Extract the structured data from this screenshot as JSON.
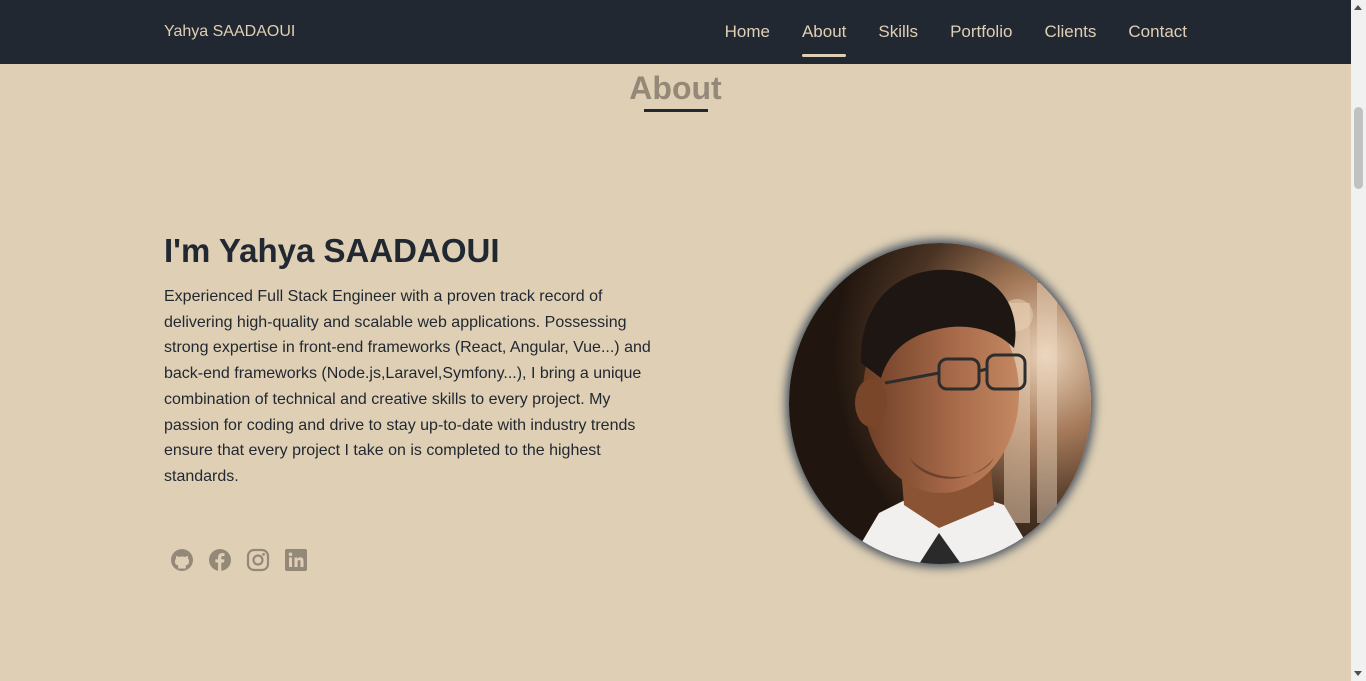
{
  "nav": {
    "brand": "Yahya SAADAOUI",
    "links": [
      "Home",
      "About",
      "Skills",
      "Portfolio",
      "Clients",
      "Contact"
    ],
    "active": "About"
  },
  "about": {
    "section_title": "About",
    "headline": "I'm Yahya SAADAOUI",
    "bio": "Experienced Full Stack Engineer with a proven track record of delivering high-quality and scalable web applications. Possessing strong expertise in front-end frameworks (React, Angular, Vue...) and back-end frameworks (Node.js,Laravel,Symfony...), I bring a unique combination of technical and creative skills to every project. My passion for coding and drive to stay up-to-date with industry trends ensure that every project I take on is completed to the highest standards.",
    "socials": [
      "github-icon",
      "facebook-icon",
      "instagram-icon",
      "linkedin-icon"
    ]
  },
  "colors": {
    "nav_bg": "#222831",
    "page_bg": "#dfd0b5",
    "muted": "#948979",
    "text": "#222831"
  }
}
